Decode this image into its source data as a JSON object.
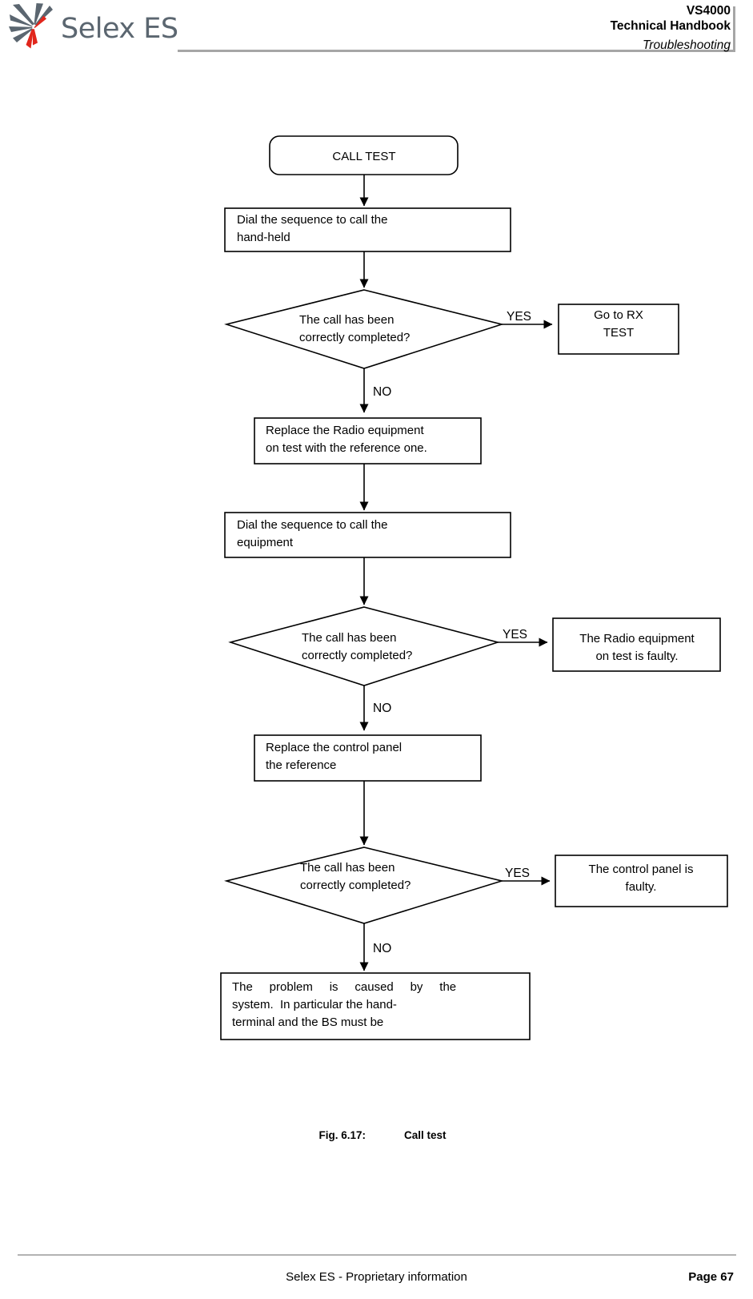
{
  "header": {
    "logo_text": "Selex ES",
    "logo_icon": "selex-pinwheel-logo",
    "doc_model": "VS4000",
    "doc_name": "Technical Handbook",
    "doc_section": "Troubleshooting",
    "rule_color": "#a6a6a6",
    "logo_gray": "#5b6670",
    "logo_red": "#e1261c"
  },
  "flowchart": {
    "title": "Call test flowchart",
    "nodes": [
      {
        "id": "start",
        "type": "terminator",
        "lines": [
          "CALL TEST"
        ],
        "align": "center"
      },
      {
        "id": "dial-handheld",
        "type": "process",
        "lines": [
          "Dial the sequence to call the",
          "hand-held"
        ],
        "align": "left"
      },
      {
        "id": "decision-1",
        "type": "decision",
        "lines": [
          "The call has  been",
          "correctly completed?"
        ],
        "align": "left"
      },
      {
        "id": "go-to-rx-test",
        "type": "process",
        "lines": [
          "Go to RX",
          "TEST"
        ],
        "align": "center"
      },
      {
        "id": "replace-radio",
        "type": "process",
        "lines": [
          "Replace the Radio equipment",
          "on test with the reference one."
        ],
        "align": "left"
      },
      {
        "id": "dial-equipment",
        "type": "process",
        "lines": [
          "Dial the sequence to call the",
          "equipment"
        ],
        "align": "left"
      },
      {
        "id": "decision-2",
        "type": "decision",
        "lines": [
          "The call has  been",
          "correctly completed?"
        ],
        "align": "left"
      },
      {
        "id": "radio-faulty",
        "type": "process",
        "lines": [
          "The Radio equipment",
          "on test is faulty."
        ],
        "align": "center"
      },
      {
        "id": "replace-control-panel",
        "type": "process",
        "lines": [
          "Replace the control panel",
          "the reference"
        ],
        "align": "left"
      },
      {
        "id": "decision-3",
        "type": "decision",
        "lines": [
          "The call has  been",
          "correctly completed?"
        ],
        "align": "left"
      },
      {
        "id": "control-panel-faulty",
        "type": "process",
        "lines": [
          "The control panel is",
          "faulty."
        ],
        "align": "center"
      },
      {
        "id": "system-problem",
        "type": "process",
        "lines": [
          "The     problem     is     caused     by     the",
          "system.  In particular the hand-",
          "terminal and the BS must be"
        ],
        "align": "justify"
      }
    ],
    "edge_labels": {
      "yes_1": "YES",
      "no_1": "NO",
      "yes_2": "YES",
      "no_2": "NO",
      "yes_3": "YES",
      "no_3": "NO"
    }
  },
  "figure": {
    "number": "Fig. 6.17:",
    "title": "Call test"
  },
  "footer": {
    "proprietary": "Selex ES - Proprietary information",
    "page": "Page 67",
    "rule_color": "#b3b3b3"
  }
}
